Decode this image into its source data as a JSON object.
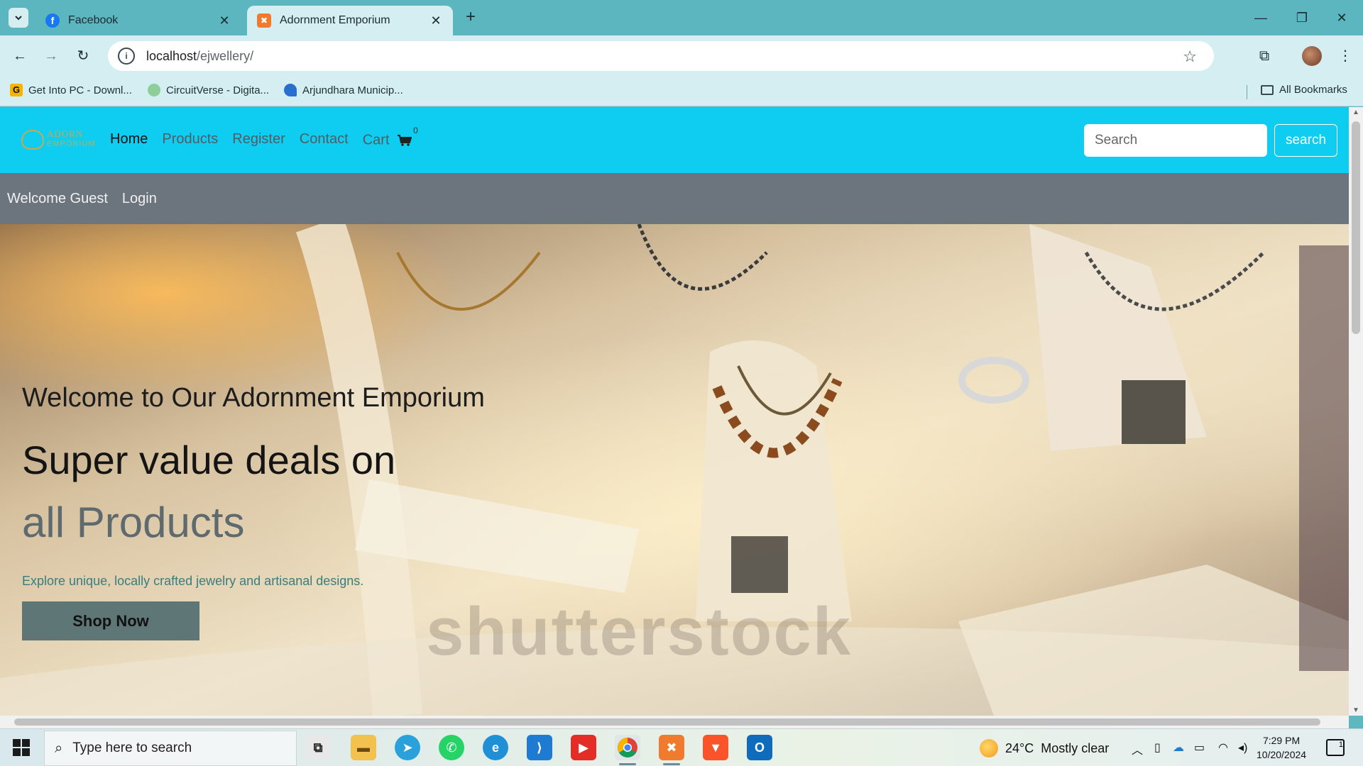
{
  "browser": {
    "tabs": [
      {
        "label": "Facebook",
        "active": false
      },
      {
        "label": "Adornment Emporium",
        "active": true
      }
    ],
    "url_host": "localhost",
    "url_path": "/ejwellery/",
    "bookmarks": [
      {
        "label": "Get Into PC - Downl..."
      },
      {
        "label": "CircuitVerse - Digita..."
      },
      {
        "label": "Arjundhara Municip..."
      }
    ],
    "all_bookmarks_label": "All Bookmarks"
  },
  "site": {
    "logo_line1": "ADORN",
    "logo_line2": "EMPORIUM",
    "menu": {
      "home": "Home",
      "products": "Products",
      "register": "Register",
      "contact": "Contact",
      "cart": "Cart",
      "cart_count": "0"
    },
    "search_placeholder": "Search",
    "search_button": "search",
    "welcome": "Welcome Guest",
    "login": "Login",
    "hero": {
      "subtitle": "Welcome to Our Adornment Emporium",
      "title_line1": "Super value deals on",
      "title_line2": "all Products",
      "description": "Explore unique, locally crafted jewelry and artisanal designs.",
      "button": "Shop Now",
      "watermark": "shutterstock"
    }
  },
  "taskbar": {
    "search_placeholder": "Type here to search",
    "weather_temp": "24°C",
    "weather_text": "Mostly clear",
    "time": "7:29 PM",
    "date": "10/20/2024",
    "notification_count": "1"
  },
  "colors": {
    "site_nav": "#0ecdf0",
    "guest_bar": "#6c757d",
    "shop_button": "#5f7676",
    "chrome_frame": "#5bb6bf"
  }
}
